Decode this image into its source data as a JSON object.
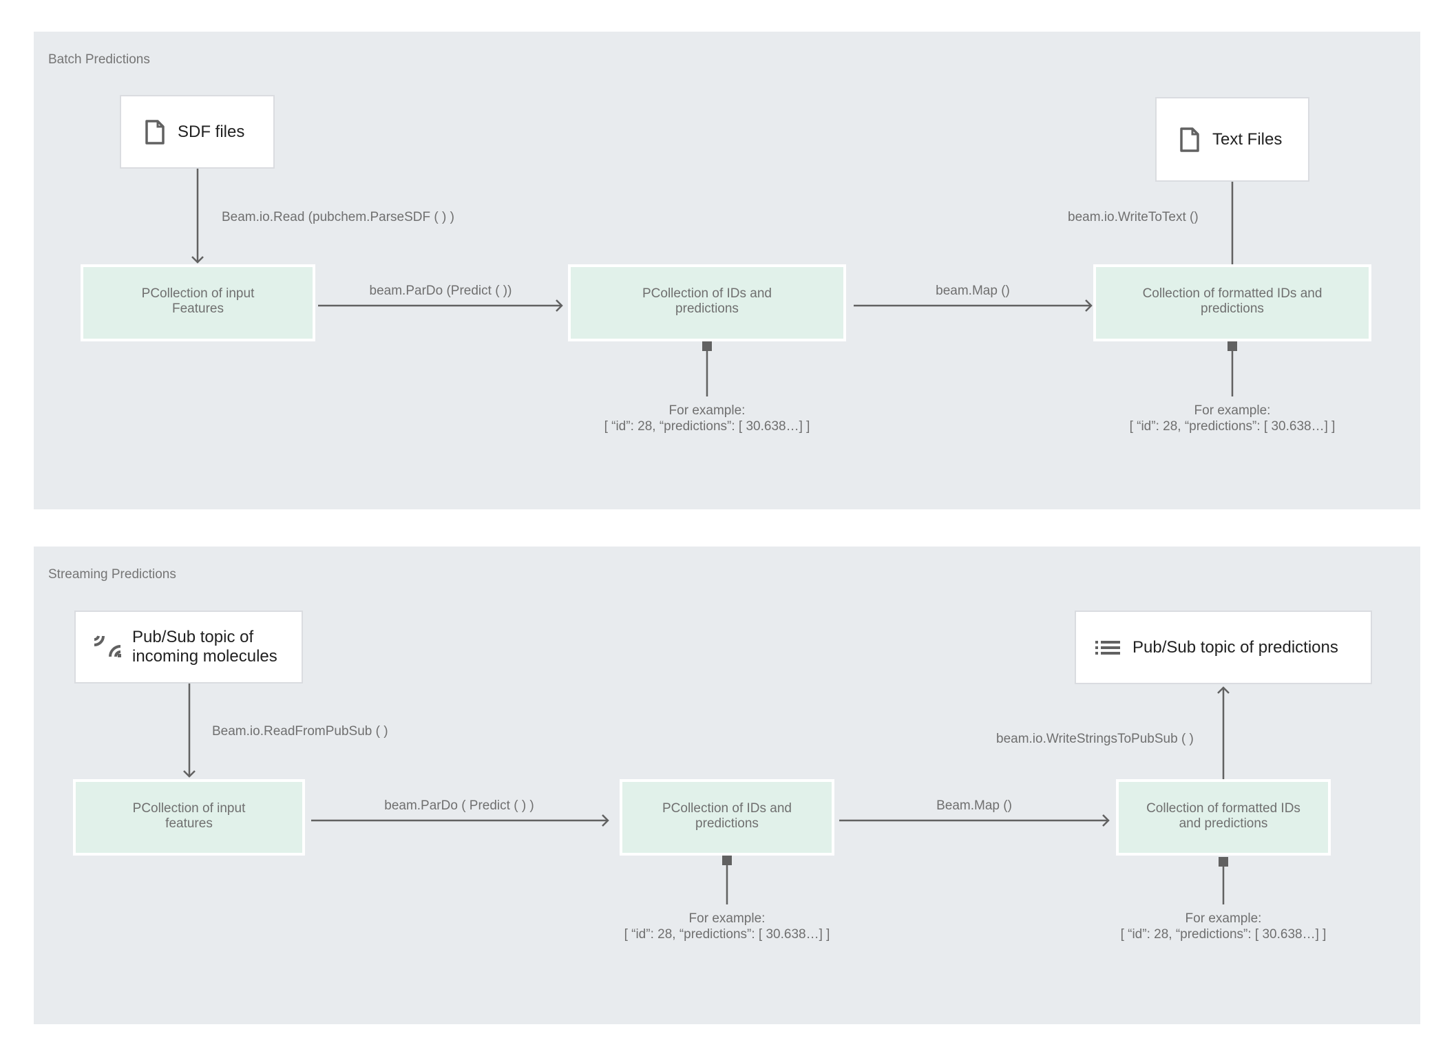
{
  "batch": {
    "title": "Batch Predictions",
    "source": {
      "label": "SDF files",
      "icon": "file-icon"
    },
    "sink": {
      "label": "Text Files",
      "icon": "file-icon"
    },
    "nodes": [
      {
        "label": "PCollection of input\nFeatures"
      },
      {
        "label": "PCollection of IDs and\npredictions"
      },
      {
        "label": "Collection of formatted IDs and\npredictions"
      }
    ],
    "edges": {
      "read": "Beam.io.Read (pubchem.ParseSDF ( ) )",
      "predict": "beam.ParDo (Predict ( ))",
      "map": "beam.Map ()",
      "write": "beam.io.WriteToText ()"
    },
    "examples": [
      {
        "line1": "For example:",
        "line2": "[ “id”: 28, “predictions”: [ 30.638…] ]"
      },
      {
        "line1": "For example:",
        "line2": "[ “id”: 28, “predictions”: [ 30.638…] ]"
      }
    ]
  },
  "streaming": {
    "title": "Streaming Predictions",
    "source": {
      "label": "Pub/Sub topic of\nincoming molecules",
      "icon": "pubsub-stream-icon"
    },
    "sink": {
      "label": "Pub/Sub topic of predictions",
      "icon": "list-icon"
    },
    "nodes": [
      {
        "label": "PCollection of input\nfeatures"
      },
      {
        "label": "PCollection of IDs and\npredictions"
      },
      {
        "label": "Collection of formatted IDs\nand predictions"
      }
    ],
    "edges": {
      "read": "Beam.io.ReadFromPubSub ( )",
      "predict": "beam.ParDo ( Predict ( ) )",
      "map": "Beam.Map ()",
      "write": "beam.io.WriteStringsToPubSub ( )"
    },
    "examples": [
      {
        "line1": "For example:",
        "line2": "[ “id”: 28, “predictions”: [ 30.638…] ]"
      },
      {
        "line1": "For example:",
        "line2": "[ “id”: 28, “predictions”: [ 30.638…] ]"
      }
    ]
  },
  "colors": {
    "panel_bg": "#e8ebee",
    "node_bg": "#e1f1ea",
    "line": "#616161",
    "text_muted": "#6f6f6f"
  }
}
